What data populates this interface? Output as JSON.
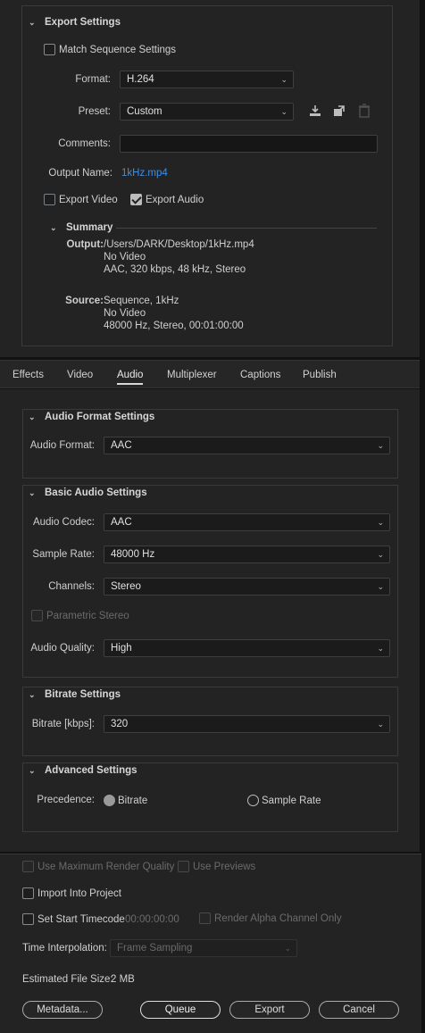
{
  "export_settings": {
    "title": "Export Settings",
    "match_sequence_label": "Match Sequence Settings",
    "format_label": "Format:",
    "format_value": "H.264",
    "preset_label": "Preset:",
    "preset_value": "Custom",
    "comments_label": "Comments:",
    "comments_value": "",
    "output_name_label": "Output Name:",
    "output_name_value": "1kHz.mp4",
    "export_video_label": "Export Video",
    "export_audio_label": "Export Audio",
    "summary": {
      "title": "Summary",
      "output_label": "Output:",
      "output_lines": [
        "/Users/DARK/Desktop/1kHz.mp4",
        "No Video",
        "AAC, 320 kbps, 48 kHz, Stereo"
      ],
      "source_label": "Source:",
      "source_lines": [
        "Sequence, 1kHz",
        "No Video",
        "48000 Hz, Stereo, 00:01:00:00"
      ]
    }
  },
  "tabs": [
    "Effects",
    "Video",
    "Audio",
    "Multiplexer",
    "Captions",
    "Publish"
  ],
  "active_tab": "Audio",
  "audio_format": {
    "title": "Audio Format Settings",
    "format_label": "Audio Format:",
    "format_value": "AAC"
  },
  "basic_audio": {
    "title": "Basic Audio Settings",
    "codec_label": "Audio Codec:",
    "codec_value": "AAC",
    "sample_rate_label": "Sample Rate:",
    "sample_rate_value": "48000 Hz",
    "channels_label": "Channels:",
    "channels_value": "Stereo",
    "parametric_stereo_label": "Parametric Stereo",
    "quality_label": "Audio Quality:",
    "quality_value": "High"
  },
  "bitrate": {
    "title": "Bitrate Settings",
    "bitrate_label": "Bitrate [kbps]:",
    "bitrate_value": "320"
  },
  "advanced": {
    "title": "Advanced Settings",
    "precedence_label": "Precedence:",
    "option_bitrate": "Bitrate",
    "option_sample_rate": "Sample Rate"
  },
  "bottom": {
    "max_render_label": "Use Maximum Render Quality",
    "use_previews_label": "Use Previews",
    "import_project_label": "Import Into Project",
    "set_start_tc_label": "Set Start Timecode",
    "start_tc_value": "00:00:00:00",
    "render_alpha_label": "Render Alpha Channel Only",
    "time_interp_label": "Time Interpolation:",
    "time_interp_value": "Frame Sampling",
    "file_size_label": "Estimated File Size:",
    "file_size_value": "2 MB"
  },
  "buttons": {
    "metadata": "Metadata...",
    "queue": "Queue",
    "export": "Export",
    "cancel": "Cancel"
  },
  "colors": {
    "panel_bg": "#232323",
    "link_blue": "#3d8ee8"
  }
}
